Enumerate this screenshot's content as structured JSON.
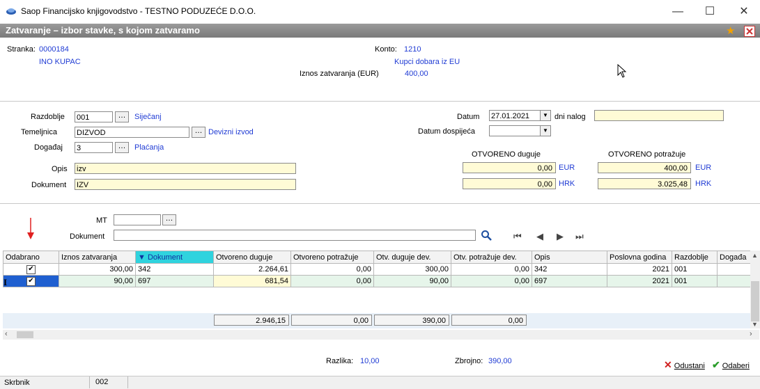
{
  "window": {
    "title": "Saop Financijsko knjigovodstvo - TESTNO PODUZEĆE D.O.O.",
    "minimize": "—",
    "maximize": "☐",
    "close": "✕"
  },
  "form": {
    "title": "Zatvaranje – izbor stavke, s kojom zatvaramo"
  },
  "info": {
    "stranka_label": "Stranka:",
    "stranka_code": "0000184",
    "stranka_name": "INO KUPAC",
    "konto_label": "Konto:",
    "konto_code": "1210",
    "konto_name": "Kupci dobara iz EU",
    "iznos_label": "Iznos zatvaranja (EUR)",
    "iznos_value": "400,00"
  },
  "fields": {
    "razdoblje_label": "Razdoblje",
    "razdoblje_value": "001",
    "razdoblje_desc": "Siječanj",
    "temeljnica_label": "Temeljnica",
    "temeljnica_value": "DIZVOD",
    "temeljnica_desc": "Devizni izvod",
    "dogadaj_label": "Događaj",
    "dogadaj_value": "3",
    "dogadaj_desc": "Plaćanja",
    "opis_label": "Opis",
    "opis_value": "izv",
    "dokument_label": "Dokument",
    "dokument_value": "IZV",
    "datum_label": "Datum",
    "datum_value": "27.01.2021",
    "dni_nalog_label": "dni nalog",
    "datum_dosp_label": "Datum dospijeća",
    "otv_duguje_label": "OTVORENO duguje",
    "otv_potrazuje_label": "OTVORENO potražuje",
    "dug_eur": "0,00",
    "pot_eur": "400,00",
    "cur1": "EUR",
    "dug_hrk": "0,00",
    "pot_hrk": "3.025,48",
    "cur2": "HRK"
  },
  "filter": {
    "mt_label": "MT",
    "dokument_label": "Dokument"
  },
  "grid": {
    "columns": [
      "Odabrano",
      "Iznos zatvaranja",
      "▼ Dokument",
      "Otvoreno duguje",
      "Otvoreno potražuje",
      "Otv. duguje dev.",
      "Otv. potražuje dev.",
      "Opis",
      "Poslovna godina",
      "Razdoblje",
      "Događa"
    ],
    "rows": [
      {
        "odabrano": "✔",
        "iznos": "300,00",
        "dokument": "342",
        "otv_dug": "2.264,61",
        "otv_pot": "0,00",
        "dug_dev": "300,00",
        "pot_dev": "0,00",
        "opis": "342",
        "godina": "2021",
        "razdoblje": "001",
        "dogadaj": ""
      },
      {
        "odabrano": "✔",
        "iznos": "90,00",
        "dokument": "697",
        "otv_dug": "681,54",
        "otv_pot": "0,00",
        "dug_dev": "90,00",
        "pot_dev": "0,00",
        "opis": "697",
        "godina": "2021",
        "razdoblje": "001",
        "dogadaj": ""
      }
    ],
    "totals": {
      "otv_dug": "2.946,15",
      "otv_pot": "0,00",
      "dug_dev": "390,00",
      "pot_dev": "0,00"
    },
    "row_marker": "I"
  },
  "summary": {
    "razlika_label": "Razlika:",
    "razlika_value": "10,00",
    "zbrojno_label": "Zbrojno:",
    "zbrojno_value": "390,00"
  },
  "buttons": {
    "odustani": "Odustani",
    "odaberi": "Odaberi"
  },
  "status": {
    "skrbnik_label": "Skrbnik",
    "skrbnik_value": "002"
  },
  "colors": {
    "link_blue": "#1f3bd4",
    "header_gray": "#8a8a8a",
    "selected_row": "#e6f5ea",
    "field_yellow": "#fffbd6",
    "arrow_red": "#e02020"
  }
}
